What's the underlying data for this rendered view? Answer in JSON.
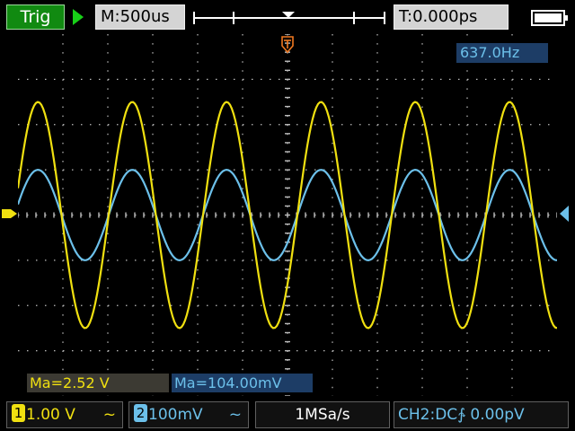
{
  "colors": {
    "ch1": "#f0e010",
    "ch2": "#6cc0ea",
    "grid": "#bdbdbd",
    "trigger_marker": "#f07820",
    "run_state": "#18d018"
  },
  "header": {
    "trigger_label": "Trig",
    "run_state_icon": "play-triangle-icon",
    "timebase": "M:500us",
    "trigger_offset": "T:0.000ps",
    "battery_icon": "battery-icon"
  },
  "readouts": {
    "frequency": "637.0Hz",
    "ch1_measure": "Ma=2.52 V",
    "ch2_measure": "Ma=104.00mV"
  },
  "markers": {
    "trigger_point_icon": "trigger-point-icon",
    "ch1_ground_icon": "ch1-level-arrow-icon",
    "ch2_level_icon": "ch2-level-arrow-icon"
  },
  "footer": {
    "ch1_number": "1",
    "ch1_scale": "1.00 V",
    "ch1_coupling": "~",
    "ch2_number": "2",
    "ch2_scale": "100mV",
    "ch2_coupling": "~",
    "sample_rate": "1MSa/s",
    "trigger_info": "CH2:DC∱  0.00pV"
  },
  "waveforms": {
    "ch1": {
      "shape": "sine",
      "period_div": 2.1,
      "peak_div": 2.5,
      "phase_div": 0.0
    },
    "ch2": {
      "shape": "sine",
      "period_div": 2.1,
      "peak_div": 1.0,
      "phase_div": 0.0
    }
  }
}
